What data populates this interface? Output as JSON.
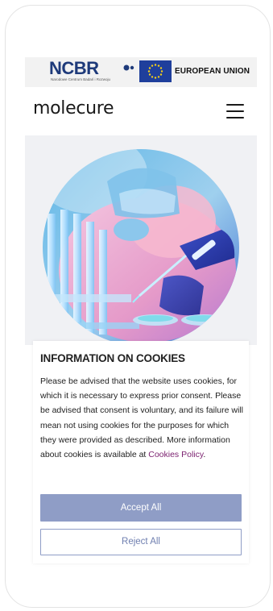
{
  "eu_banner": {
    "ncbr_logo_text": "NCBR",
    "ncbr_subtitle": "Narodowe Centrum Badań i Rozwoju",
    "eu_label": "EUROPEAN UNION"
  },
  "header": {
    "logo_text": "molecure",
    "menu_icon": "hamburger-menu-icon"
  },
  "hero": {
    "image": "scientist-with-pipette-and-test-tubes"
  },
  "cookies": {
    "title": "INFORMATION ON COOKIES",
    "body_text": "Please be advised that the website uses cookies, for which it is necessary to express prior consent. Please be advised that consent is voluntary, and its failure will mean not using cookies for the purposes for which they were provided as described. More information about cookies is available at ",
    "policy_link": "Cookies Policy",
    "trailing_text": ".",
    "accept_label": "Accept All",
    "reject_label": "Reject All"
  },
  "colors": {
    "accept_bg": "#8f9dc6",
    "reject_text": "#6f7fb0",
    "link": "#7a1f6e",
    "eu_flag": "#1f3f9c",
    "ncbr_blue": "#1e3a7a"
  }
}
